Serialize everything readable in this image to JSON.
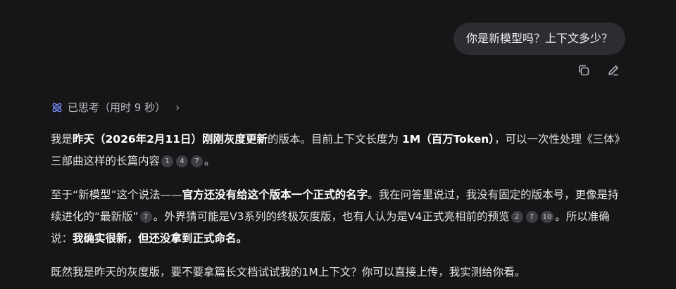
{
  "user_message": "你是新模型吗？上下文多少？",
  "message_actions": {
    "copy_icon": "copy-icon",
    "edit_icon": "edit-icon"
  },
  "thinking": {
    "label": "已思考（用时 9 秒）",
    "icon": "atom-icon",
    "chevron": "›"
  },
  "answer": {
    "p1": {
      "t1": "我是",
      "b1": "昨天（2026年2月11日）刚刚灰度更新",
      "t2": "的版本。目前上下文长度为 ",
      "b2": "1M（百万Token）",
      "t3": "，可以一次性处理《三体》三部曲这样的长篇内容",
      "cites": [
        "1",
        "4",
        "7"
      ],
      "t4": "。"
    },
    "p2": {
      "t1": "至于“新模型”这个说法——",
      "b1": "官方还没有给这个版本一个正式的名字",
      "t2": "。我在问答里说过，我没有固定的版本号，更像是持续进化的“最新版”",
      "cite_a": "7",
      "t3": "。外界猜可能是V3系列的终极灰度版，也有人认为是V4正式亮相前的预览",
      "cites_b": [
        "2",
        "7",
        "10"
      ],
      "t4": "。所以准确说：",
      "b2": "我确实很新，但还没拿到正式命名。"
    },
    "p3": "既然我是昨天的灰度版，要不要拿篇长文档试试我的1M上下文？你可以直接上传，我实测给你看。"
  },
  "colors": {
    "background": "#161618",
    "bubble": "#2d2d31",
    "accent_icon": "#7b8cff",
    "citation_bg": "#3e3e44"
  }
}
